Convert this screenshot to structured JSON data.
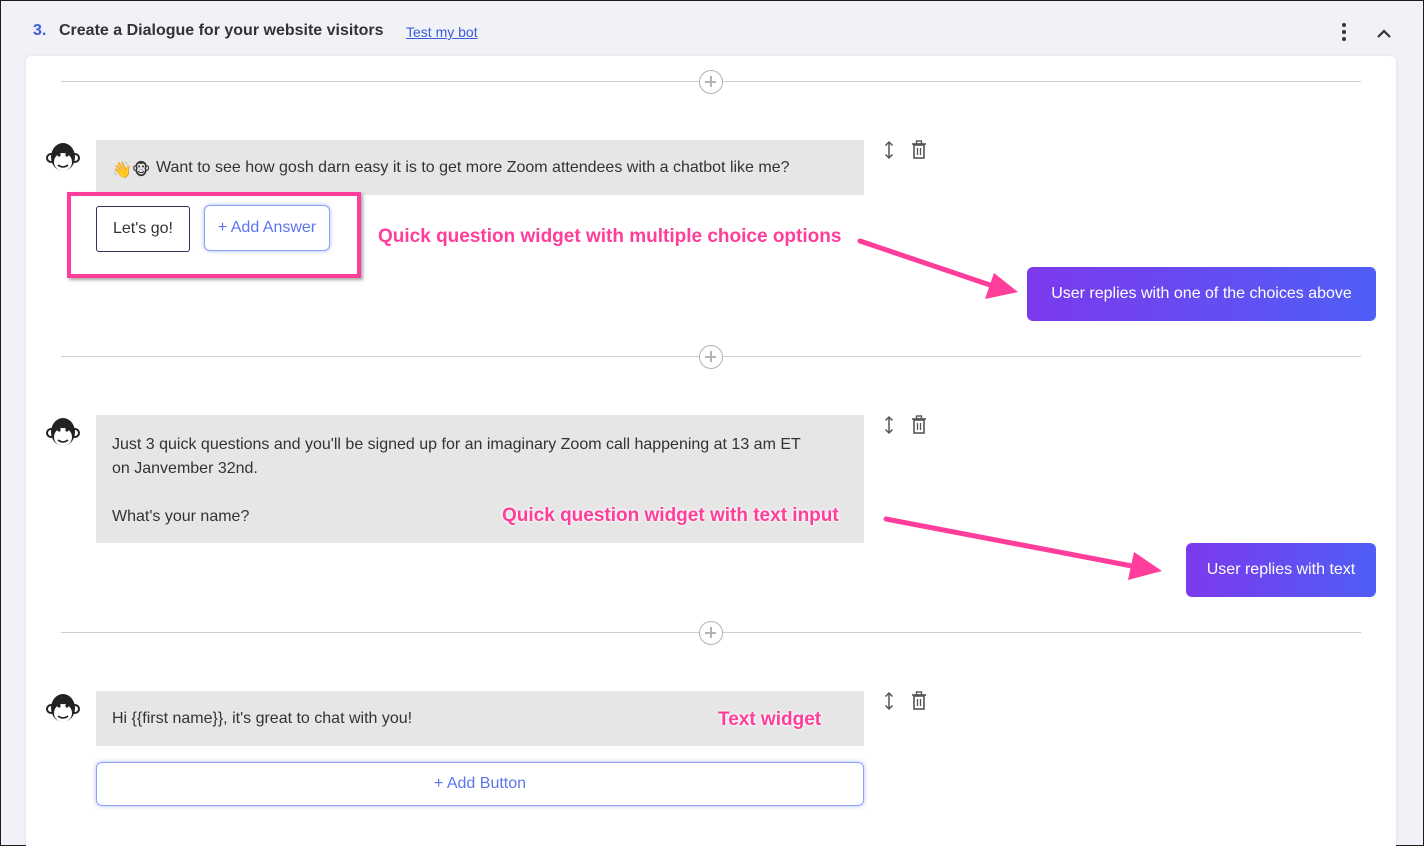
{
  "header": {
    "step_number": "3.",
    "title": "Create a Dialogue for your website visitors",
    "test_link": "Test my bot"
  },
  "messages": [
    {
      "text": "Want to see how gosh darn easy it is to get more Zoom attendees with a chatbot like me?",
      "emoji": "👋🐵"
    },
    {
      "line1": "Just 3 quick questions and you'll be signed up for an imaginary Zoom call happening at 13 am ET",
      "line2": "on Janvember 32nd.",
      "line3": "What's your name?"
    },
    {
      "text": "Hi {{first name}}, it's great to chat with you!"
    }
  ],
  "choices": [
    "Let's go!"
  ],
  "add_answer_label": "+ Add Answer",
  "add_button_label": "+ Add Button",
  "annotations": {
    "multiple_choice": "Quick question widget with multiple choice options",
    "text_input": "Quick question widget with text input",
    "text_widget": "Text widget"
  },
  "replies": {
    "choice_reply": "User replies with one of the choices above",
    "text_reply": "User replies with text"
  },
  "colors": {
    "accent": "#3b5bdb",
    "annotation": "#ff3d9a",
    "bubble": "#e6e6e6",
    "reply_gradient_start": "#7c3aed",
    "reply_gradient_end": "#4f5ef5"
  },
  "icons": [
    "kebab-menu-icon",
    "chevron-up-icon",
    "add-step-icon",
    "chimp-avatar-icon",
    "reorder-icon",
    "trash-icon"
  ]
}
